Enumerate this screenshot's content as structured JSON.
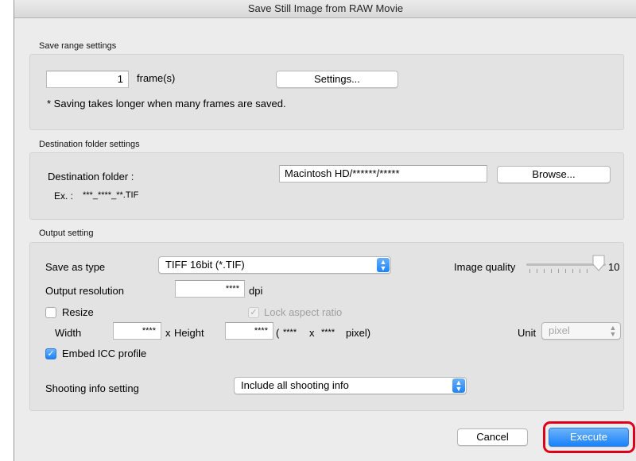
{
  "window": {
    "title": "Save Still Image from RAW Movie"
  },
  "save_range": {
    "heading": "Save range settings",
    "frames_value": "1",
    "frames_unit": "frame(s)",
    "settings_button": "Settings...",
    "note": "* Saving takes longer when many frames are saved."
  },
  "destination": {
    "heading": "Destination folder settings",
    "folder_label": "Destination folder :",
    "folder_value": "Macintosh HD/******/*****",
    "browse_button": "Browse...",
    "example_label": "Ex. :",
    "example_value": "***_****_**.TIF"
  },
  "output": {
    "heading": "Output setting",
    "save_as_label": "Save as type",
    "save_as_value": "TIFF 16bit (*.TIF)",
    "image_quality_label": "Image quality",
    "image_quality_value": "10",
    "image_quality_level": 10,
    "resolution_label": "Output resolution",
    "resolution_value": "****",
    "resolution_unit": "dpi",
    "resize_label": "Resize",
    "resize_checked": false,
    "lock_aspect_label": "Lock aspect ratio",
    "lock_aspect_checked": true,
    "width_label": "Width",
    "width_value": "****",
    "x_label": "x",
    "height_label": "Height",
    "height_value": "****",
    "pixel_open": "(",
    "pixel_w": "****",
    "pixel_x": "x",
    "pixel_h": "****",
    "pixel_close": "pixel)",
    "unit_label": "Unit",
    "unit_value": "pixel",
    "embed_icc_label": "Embed ICC profile",
    "embed_icc_checked": true,
    "shooting_info_label": "Shooting info setting",
    "shooting_info_value": "Include all shooting info"
  },
  "footer": {
    "cancel_button": "Cancel",
    "execute_button": "Execute"
  },
  "colors": {
    "accent": "#1a82fb",
    "highlight": "#e0001a"
  }
}
